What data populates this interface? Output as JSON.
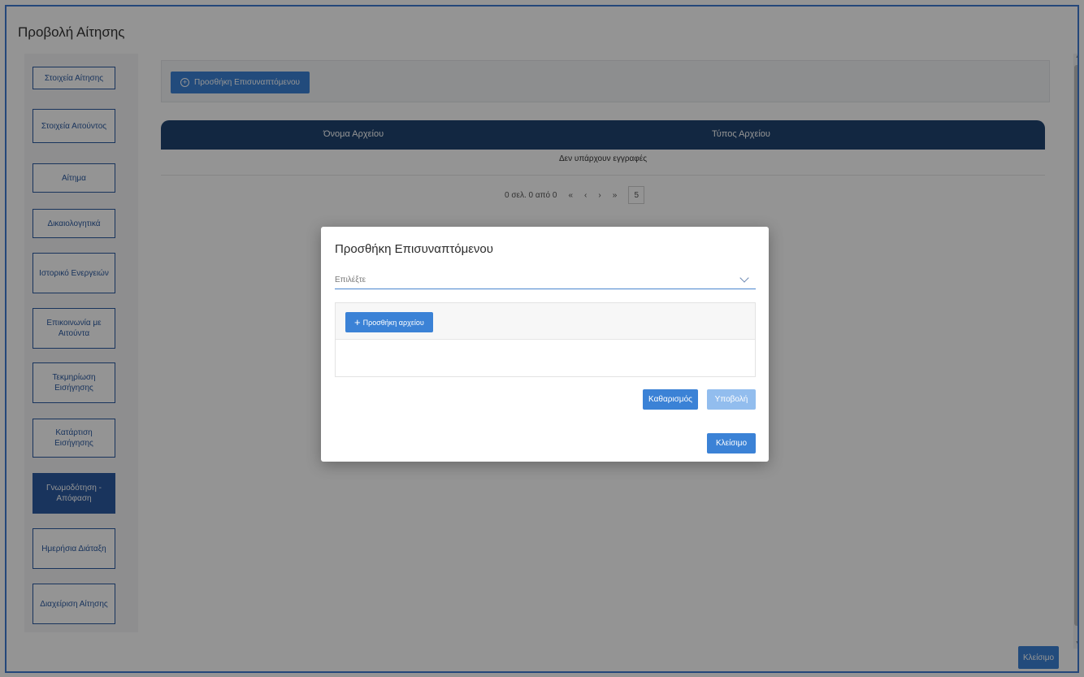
{
  "page_title": "Προβολή Αίτησης",
  "sidebar": {
    "items": [
      {
        "label": "Στοιχεία Αίτησης"
      },
      {
        "label": "Στοιχεία Αιτούντος"
      },
      {
        "label": "Αίτημα"
      },
      {
        "label": "Δικαιολογητικά"
      },
      {
        "label": "Ιστορικό Ενεργειών"
      },
      {
        "label": "Επικοινωνία με Αιτούντα"
      },
      {
        "label": "Τεκμηρίωση Εισήγησης"
      },
      {
        "label": "Κατάρτιση Εισήγησης"
      },
      {
        "label": "Γνωμοδότηση - Απόφαση"
      },
      {
        "label": "Ημερήσια Διάταξη"
      },
      {
        "label": "Διαχείριση Αίτησης"
      }
    ],
    "active_index": 8
  },
  "toolbar": {
    "add_attachment_label": "Προσθήκη Επισυναπτόμενου"
  },
  "table": {
    "columns": [
      "Όνομα Αρχείου",
      "Τύπος Αρχείου"
    ],
    "empty_message": "Δεν υπάρχουν εγγραφές",
    "pagination": {
      "range_text": "0 σελ. 0 από 0",
      "first": "«",
      "prev": "‹",
      "next": "›",
      "last": "»",
      "page_size": "5"
    }
  },
  "bottom": {
    "close_label": "Κλείσιμο"
  },
  "modal": {
    "title": "Προσθήκη Επισυναπτόμενου",
    "select_placeholder": "Επιλέξτε",
    "add_file_label": "Προσθήκη αρχείου",
    "clear_label": "Καθαρισμός",
    "submit_label": "Υποβολή",
    "close_label": "Κλείσιμο"
  },
  "colors": {
    "accent": "#3b82d6",
    "header_dark": "#1f4470",
    "sidebar_border": "#2b5aa0",
    "frame_border": "#3f7ad2"
  }
}
